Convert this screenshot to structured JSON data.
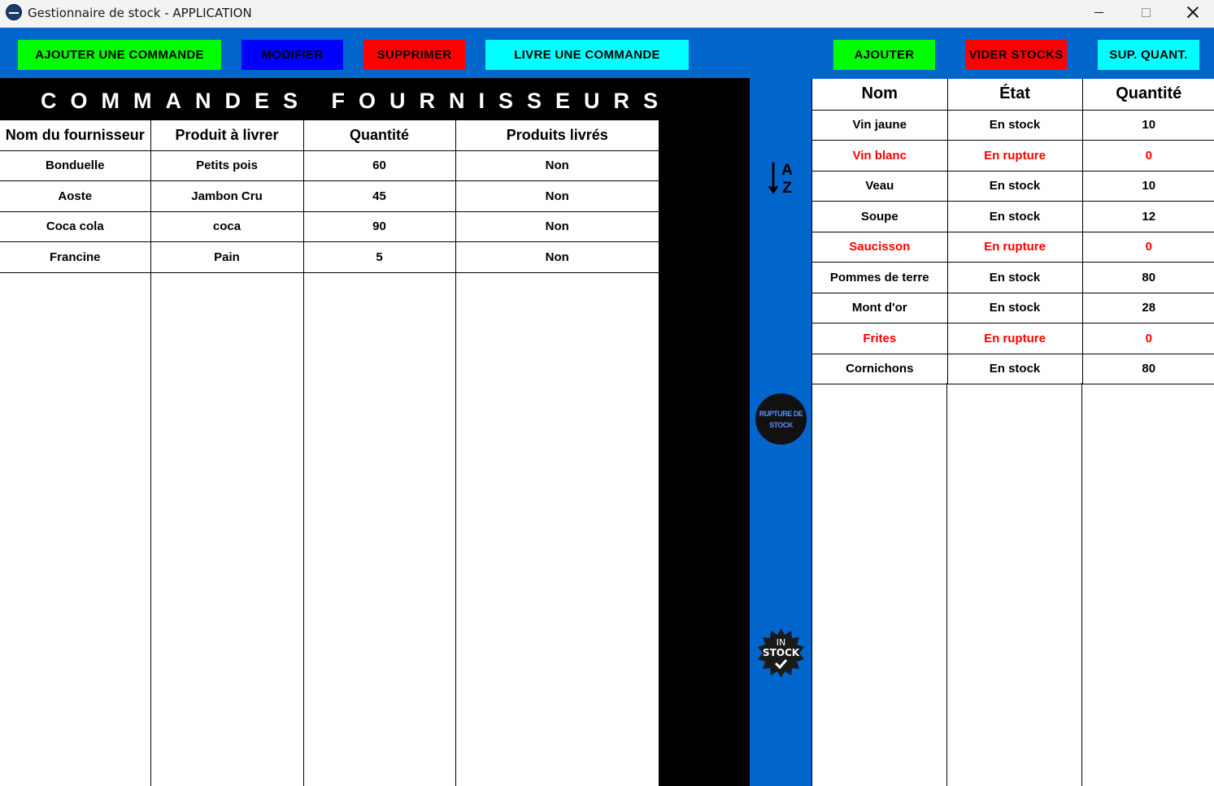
{
  "window": {
    "title": "Gestionnaire de stock - APPLICATION"
  },
  "toolbar": {
    "add_order": "AJOUTER UNE COMMANDE",
    "modify": "MODIFIER",
    "delete": "SUPPRIMER",
    "deliver_order": "LIVRE UNE COMMANDE",
    "add": "AJOUTER",
    "empty_stocks": "VIDER STOCKS",
    "sup_quant": "SUP. QUANT."
  },
  "orders": {
    "title": "COMMANDES FOURNISSEURS",
    "headers": [
      "Nom du fournisseur",
      "Produit à livrer",
      "Quantité",
      "Produits livrés"
    ],
    "rows": [
      [
        "Bonduelle",
        "Petits pois",
        "60",
        "Non"
      ],
      [
        "Aoste",
        "Jambon Cru",
        "45",
        "Non"
      ],
      [
        "Coca cola",
        "coca",
        "90",
        "Non"
      ],
      [
        "Francine",
        "Pain",
        "5",
        "Non"
      ]
    ]
  },
  "sidebar": {
    "sort_icon": "sort-az-icon",
    "rupture_label_1": "RUPTURE DE",
    "rupture_label_2": "STOCK",
    "instock_label_1": "IN",
    "instock_label_2": "STOCK"
  },
  "stock": {
    "headers": [
      "Nom",
      "État",
      "Quantité"
    ],
    "rows": [
      {
        "name": "Vin jaune",
        "state": "En stock",
        "qty": "10",
        "out": false
      },
      {
        "name": "Vin blanc",
        "state": "En rupture",
        "qty": "0",
        "out": true
      },
      {
        "name": "Veau",
        "state": "En stock",
        "qty": "10",
        "out": false
      },
      {
        "name": "Soupe",
        "state": "En stock",
        "qty": "12",
        "out": false
      },
      {
        "name": "Saucisson",
        "state": "En rupture",
        "qty": "0",
        "out": true
      },
      {
        "name": "Pommes de terre",
        "state": "En stock",
        "qty": "80",
        "out": false
      },
      {
        "name": "Mont d'or",
        "state": "En stock",
        "qty": "28",
        "out": false
      },
      {
        "name": "Frites",
        "state": "En rupture",
        "qty": "0",
        "out": true
      },
      {
        "name": "Cornichons",
        "state": "En stock",
        "qty": "80",
        "out": false
      }
    ]
  },
  "colors": {
    "background_blue": "#0066cc",
    "green": "#00ff00",
    "blue": "#0000ff",
    "red": "#ff0000",
    "cyan": "#00ffff"
  }
}
